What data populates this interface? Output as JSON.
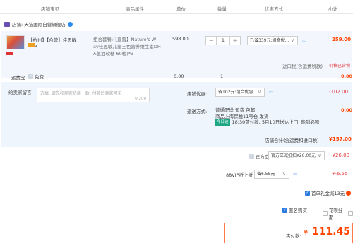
{
  "header": {
    "col_shop": "店铺宝贝",
    "col_attr": "商品属性",
    "col_price": "单价",
    "col_qty": "数量",
    "col_discount": "优惠方式",
    "col_subtotal": "小计"
  },
  "shop": {
    "name": "店铺: 天猫国际自营旗舰店"
  },
  "item": {
    "title": "【杭州】【合营】佳思敏dha...",
    "attr_line1": "组合套餐:(【直营】Nature's W",
    "attr_line2": "ay佳思敏儿童三色营养维生素DH",
    "attr_line3": "A鱼油软糖 60粒)*3",
    "price": "598.00",
    "qty": "1",
    "qty_minus": "−",
    "qty_plus": "+",
    "discount_select": "已省339元:组合优...",
    "subtotal": "259.00",
    "import_tax_label": "进口税(含运费税款)",
    "import_tax_value": "价格已含税"
  },
  "shipping": {
    "label": "运费宝",
    "free": "免费",
    "price": "0.00",
    "qty": "1",
    "value": "0.00"
  },
  "message": {
    "label": "给卖家留言:",
    "placeholder": "选填, 请先和商家协商一致, 付款后商家可见",
    "counter": "0/200"
  },
  "shop_discount": {
    "label": "店铺优惠:",
    "select": "省102元:组合优惠",
    "value": "-102.00"
  },
  "delivery": {
    "label": "运送方式:",
    "method": "普通配送 运费 包邮",
    "from": "商品上海保税11号仓 发货",
    "badge": "今日达",
    "eta": "18:30前付款, 5月10日送达上门, 晚到必赔",
    "value": "0.00"
  },
  "shop_total": {
    "label": "店铺合计(含运费和进口税)",
    "value": "¥157.00"
  },
  "official": {
    "label": "官方立减",
    "select": "官方立减抵扣¥26.00元",
    "value": "-¥26.00"
  },
  "vip": {
    "label": "88VIP折上折",
    "select": "省6.55元",
    "value": "¥-6.55"
  },
  "gift": {
    "label": "首单礼金减13元"
  },
  "options": {
    "anonymous": "匿名购买",
    "huabei": "花呗分期"
  },
  "final": {
    "label": "实付款:",
    "currency": "¥",
    "amount": "111.45"
  },
  "colors": {
    "accent": "#ff5000",
    "blue": "#2b7ae0",
    "row_bg": "#f3f7fd"
  }
}
